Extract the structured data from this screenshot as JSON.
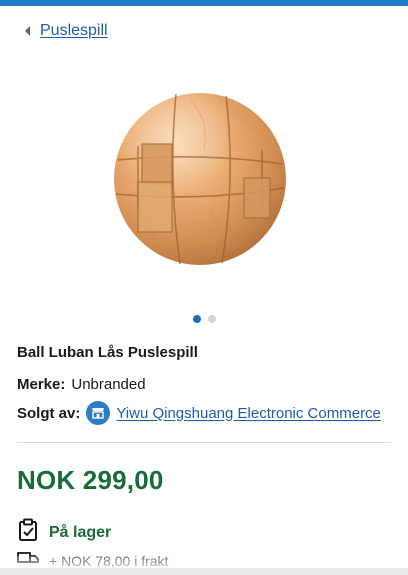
{
  "breadcrumb": {
    "label": "Puslespill"
  },
  "product": {
    "title": "Ball Luban Lås Puslespill",
    "brand_label": "Merke:",
    "brand_value": "Unbranded",
    "seller_label": "Solgt av:",
    "seller_name": "Yiwu Qingshuang Electronic Commerce",
    "price": "NOK 299,00",
    "stock": "På lager",
    "shipping": "+ NOK 78,00 i frakt"
  },
  "gallery": {
    "image_count": 2,
    "active_index": 0
  },
  "colors": {
    "accent_blue": "#1f78c8",
    "link": "#1a5ea8",
    "price_green": "#1a6b3c"
  },
  "icons": {
    "back": "chevron-left-icon",
    "store": "store-icon",
    "stock": "clipboard-check-icon",
    "shipping": "truck-icon"
  }
}
